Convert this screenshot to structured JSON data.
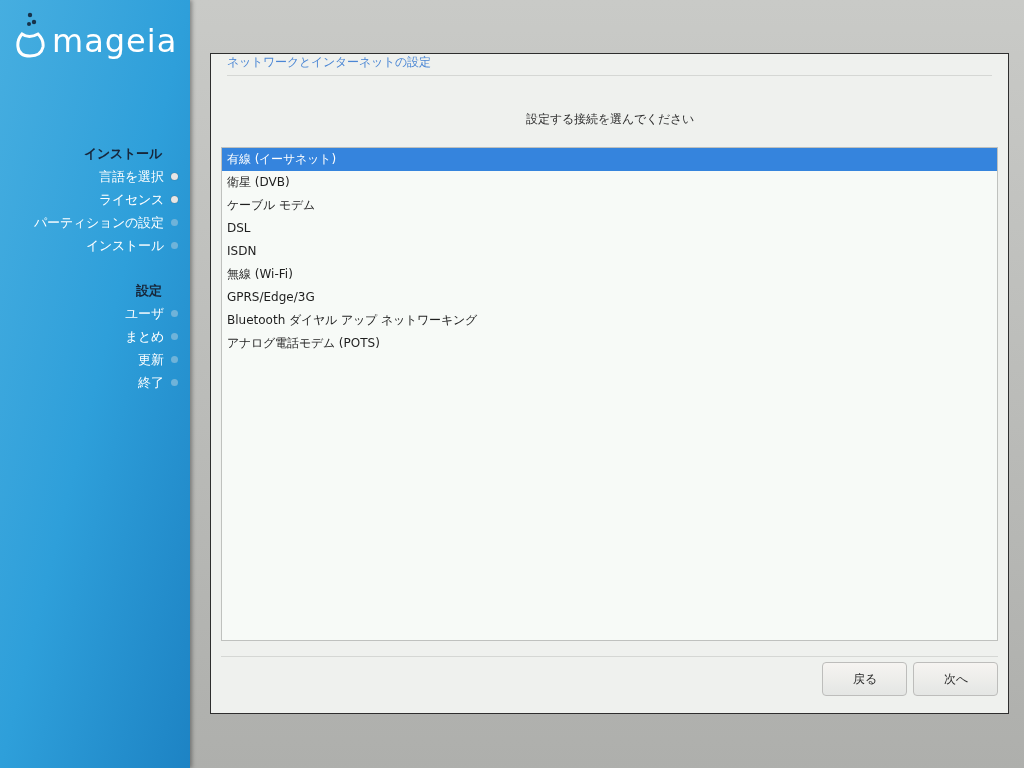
{
  "logo": {
    "text": "mageia"
  },
  "sidebar": {
    "sections": [
      {
        "title": "インストール",
        "steps": [
          {
            "label": "言語を選択",
            "done": true
          },
          {
            "label": "ライセンス",
            "done": true
          },
          {
            "label": "パーティションの設定",
            "done": false
          },
          {
            "label": "インストール",
            "done": false
          }
        ]
      },
      {
        "title": "設定",
        "steps": [
          {
            "label": "ユーザ",
            "done": false
          },
          {
            "label": "まとめ",
            "done": false
          },
          {
            "label": "更新",
            "done": false
          },
          {
            "label": "終了",
            "done": false
          }
        ]
      }
    ]
  },
  "dialog": {
    "title": "ネットワークとインターネットの設定",
    "prompt": "設定する接続を選んでください",
    "options": [
      {
        "label": "有線 (イーサネット)",
        "selected": true
      },
      {
        "label": "衛星 (DVB)",
        "selected": false
      },
      {
        "label": "ケーブル モデム",
        "selected": false
      },
      {
        "label": "DSL",
        "selected": false
      },
      {
        "label": "ISDN",
        "selected": false
      },
      {
        "label": "無線 (Wi-Fi)",
        "selected": false
      },
      {
        "label": "GPRS/Edge/3G",
        "selected": false
      },
      {
        "label": "Bluetooth ダイヤル アップ ネットワーキング",
        "selected": false
      },
      {
        "label": "アナログ電話モデム (POTS)",
        "selected": false
      }
    ],
    "buttons": [
      "戻る",
      "次へ"
    ]
  }
}
